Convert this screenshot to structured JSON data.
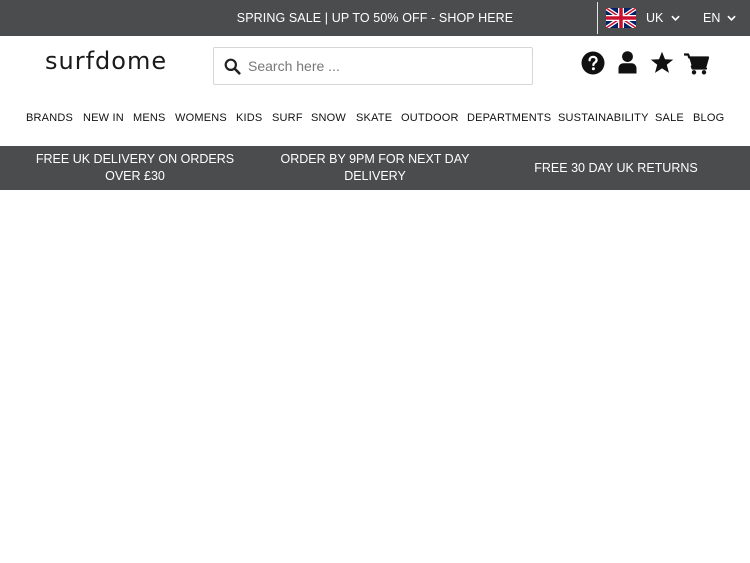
{
  "topbar": {
    "promo": "SPRING SALE | UP TO 50% OFF - SHOP HERE",
    "region": "UK",
    "language": "EN",
    "flag_icon": "uk-flag-icon"
  },
  "header": {
    "logo": "surfdome",
    "search": {
      "placeholder": "Search here ...",
      "value": ""
    },
    "icons": [
      "help-icon",
      "account-icon",
      "wishlist-star-icon",
      "cart-icon"
    ]
  },
  "nav": {
    "items": [
      "BRANDS",
      "NEW IN",
      "MENS",
      "WOMENS",
      "KIDS",
      "SURF",
      "SNOW",
      "SKATE",
      "OUTDOOR",
      "DEPARTMENTS",
      "SUSTAINABILITY",
      "SALE",
      "BLOG"
    ]
  },
  "usp": {
    "items": [
      "FREE UK DELIVERY ON ORDERS OVER £30",
      "ORDER BY 9PM FOR NEXT DAY DELIVERY",
      "FREE 30 DAY UK RETURNS"
    ]
  },
  "colors": {
    "bar_bg": "#4a4c4e",
    "text_dark": "#111111",
    "white": "#ffffff"
  }
}
